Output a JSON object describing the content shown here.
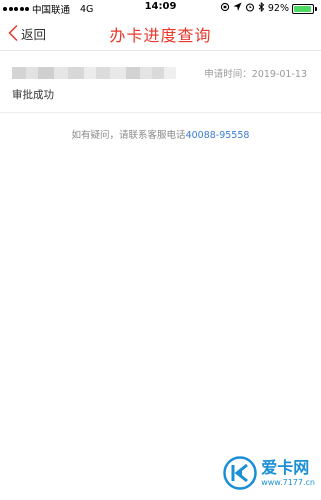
{
  "status_bar": {
    "carrier": "中国联通",
    "network": "4G",
    "time": "14:09",
    "battery_percent": "92%",
    "battery_level": 0.92
  },
  "nav": {
    "back_label": "返回",
    "title": "办卡进度查询"
  },
  "record": {
    "apply_date": "申请时间：2019-01-13",
    "status": "审批成功"
  },
  "help": {
    "prefix": "如有疑问，请联系客服电话",
    "phone": "40088-95558"
  },
  "watermark": {
    "brand": "爱卡网",
    "domain": "www.7177.cn"
  },
  "colors": {
    "accent": "#e8382b",
    "link": "#3a7bd5",
    "battery": "#4cd964",
    "watermark": "#1a8fd6"
  }
}
